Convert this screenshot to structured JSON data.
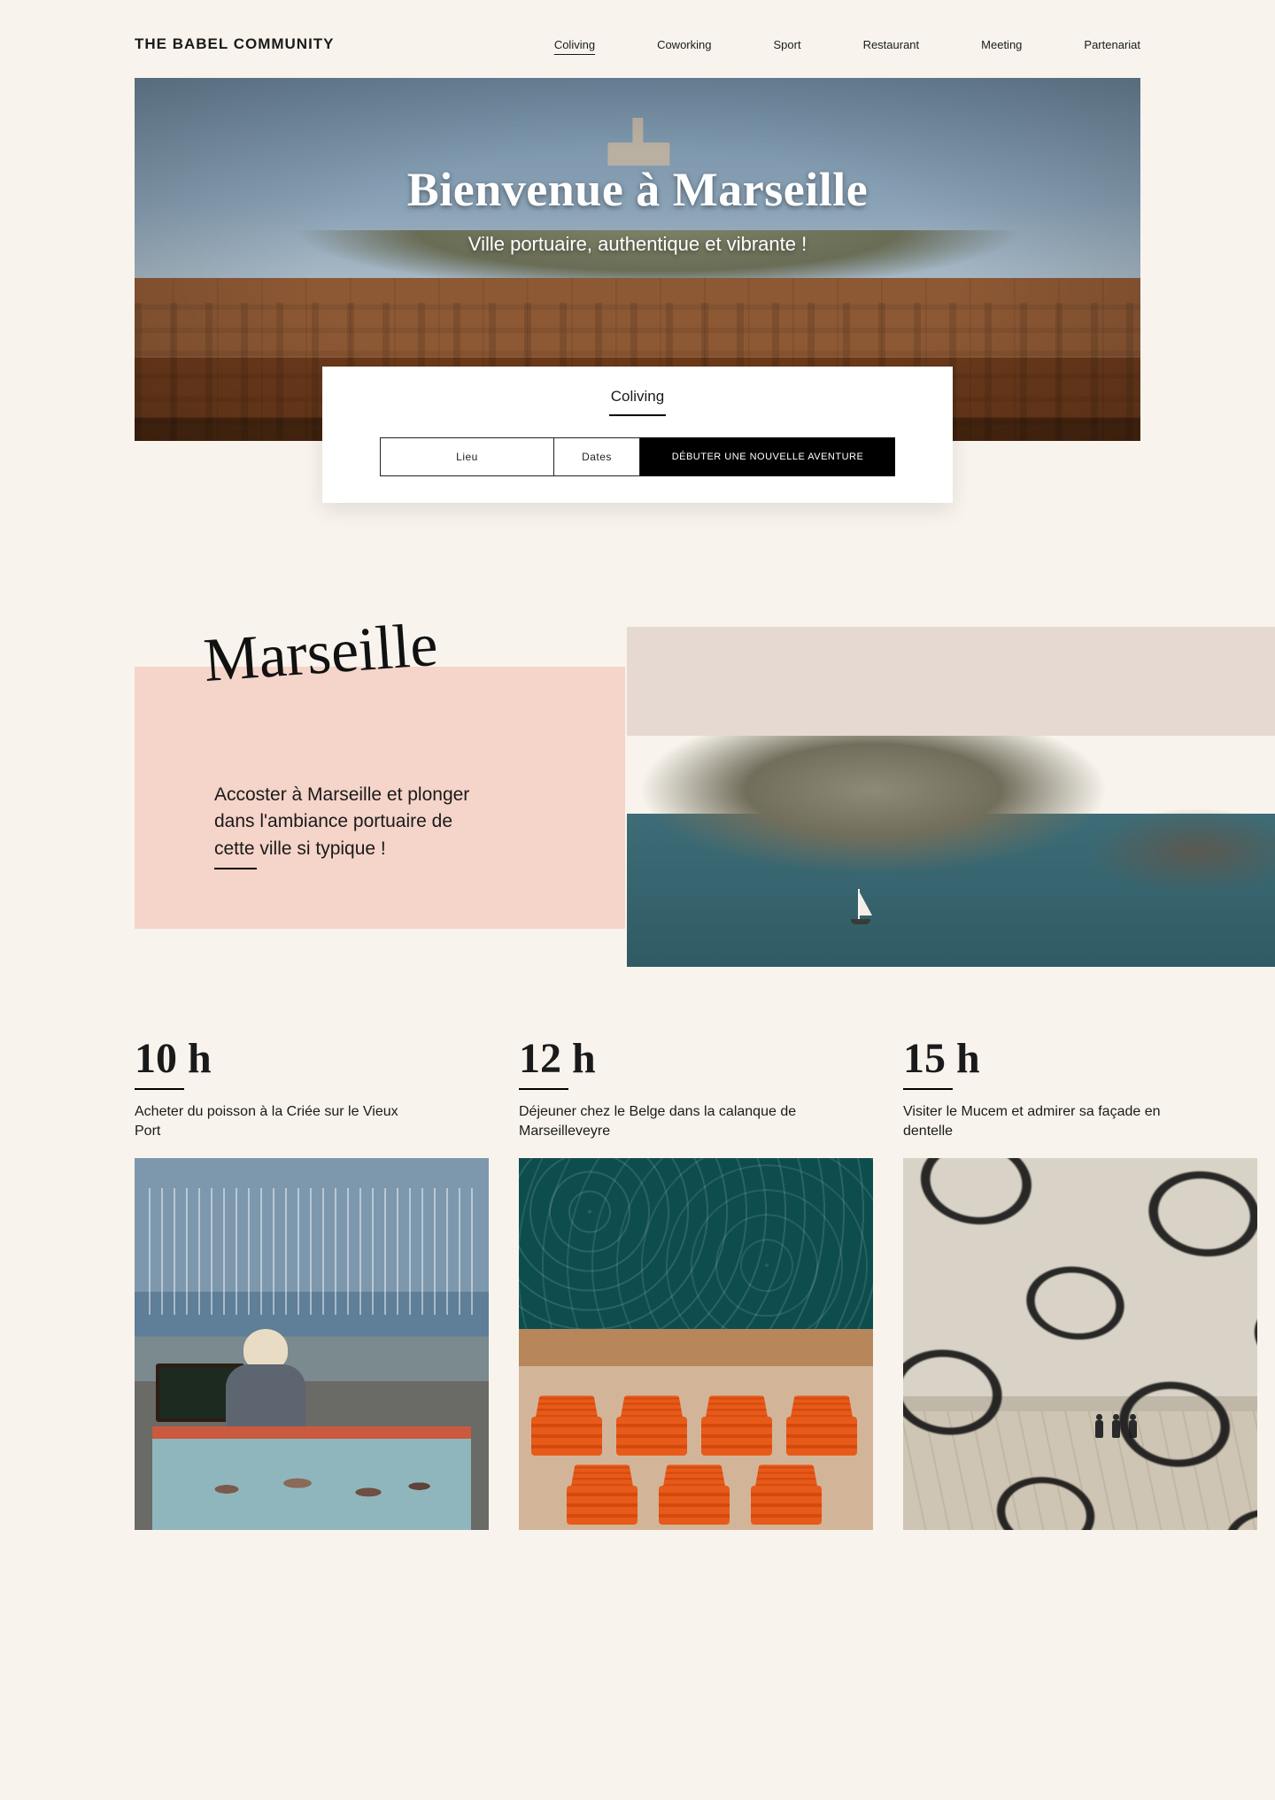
{
  "header": {
    "brand": "THE BABEL COMMUNITY",
    "nav": [
      "Coliving",
      "Coworking",
      "Sport",
      "Restaurant",
      "Meeting",
      "Partenariat"
    ],
    "active_index": 0
  },
  "hero": {
    "title": "Bienvenue à Marseille",
    "subtitle": "Ville portuaire, authentique et vibrante !"
  },
  "booking": {
    "tab": "Coliving",
    "field_lieu": "Lieu",
    "field_dates": "Dates",
    "cta": "DÉBUTER UNE NOUVELLE AVENTURE"
  },
  "city": {
    "script_name": "Marseille",
    "lead_line1": "Accoster à Marseille et plonger",
    "lead_line2": "dans l'ambiance portuaire de",
    "lead_line3": "cette ville si typique !"
  },
  "hours": [
    {
      "time": "10 h",
      "desc": "Acheter du poisson à la Criée sur le Vieux Port"
    },
    {
      "time": "12 h",
      "desc": "Déjeuner chez le Belge dans la calanque de Marseilleveyre"
    },
    {
      "time": "15 h",
      "desc": "Visiter le Mucem et admirer sa façade en dentelle"
    }
  ]
}
